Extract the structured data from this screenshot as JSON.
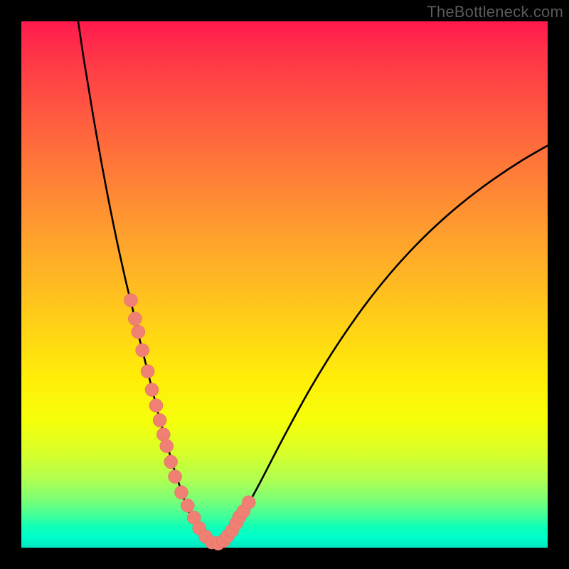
{
  "watermark": "TheBottleneck.com",
  "colors": {
    "frame": "#000000",
    "curve": "#000000",
    "marker_fill": "#f08074",
    "marker_stroke": "#e06a5e"
  },
  "chart_data": {
    "type": "line",
    "title": "",
    "xlabel": "",
    "ylabel": "",
    "xlim": [
      0,
      100
    ],
    "ylim": [
      0,
      100
    ],
    "x": [
      10.8,
      12,
      14,
      16,
      18,
      20,
      21,
      22,
      23,
      24,
      25,
      26,
      27,
      28,
      29,
      30,
      31,
      32,
      33,
      34,
      35,
      36,
      38,
      40,
      42,
      45,
      50,
      55,
      60,
      65,
      70,
      75,
      80,
      85,
      90,
      95,
      100
    ],
    "y": [
      100,
      92,
      80,
      69,
      59,
      50,
      46,
      41.5,
      37.5,
      33.5,
      29.5,
      25.5,
      22,
      18.5,
      15,
      12,
      9,
      6.5,
      4.3,
      2.7,
      1.6,
      1.2,
      1.5,
      3.2,
      6.3,
      11.7,
      21.3,
      30.4,
      38.5,
      45.7,
      52,
      57.5,
      62.3,
      66.5,
      70.2,
      73.5,
      76.4
    ],
    "markers": {
      "x": [
        20.8,
        21.6,
        22.2,
        23.0,
        24.0,
        24.8,
        25.6,
        26.3,
        27.0,
        27.6,
        28.4,
        29.2,
        30.4,
        31.6,
        32.8,
        33.8,
        35.0,
        36.2,
        37.4,
        38.4,
        39.2,
        40.0,
        40.8,
        41.4,
        42.2,
        43.2
      ],
      "y": [
        47.0,
        43.5,
        41.0,
        37.5,
        33.5,
        30.0,
        27.0,
        24.2,
        21.5,
        19.3,
        16.3,
        13.5,
        10.5,
        8.0,
        5.7,
        3.7,
        2.1,
        1.0,
        0.8,
        1.3,
        2.2,
        3.2,
        4.6,
        5.8,
        6.9,
        8.6
      ]
    }
  }
}
